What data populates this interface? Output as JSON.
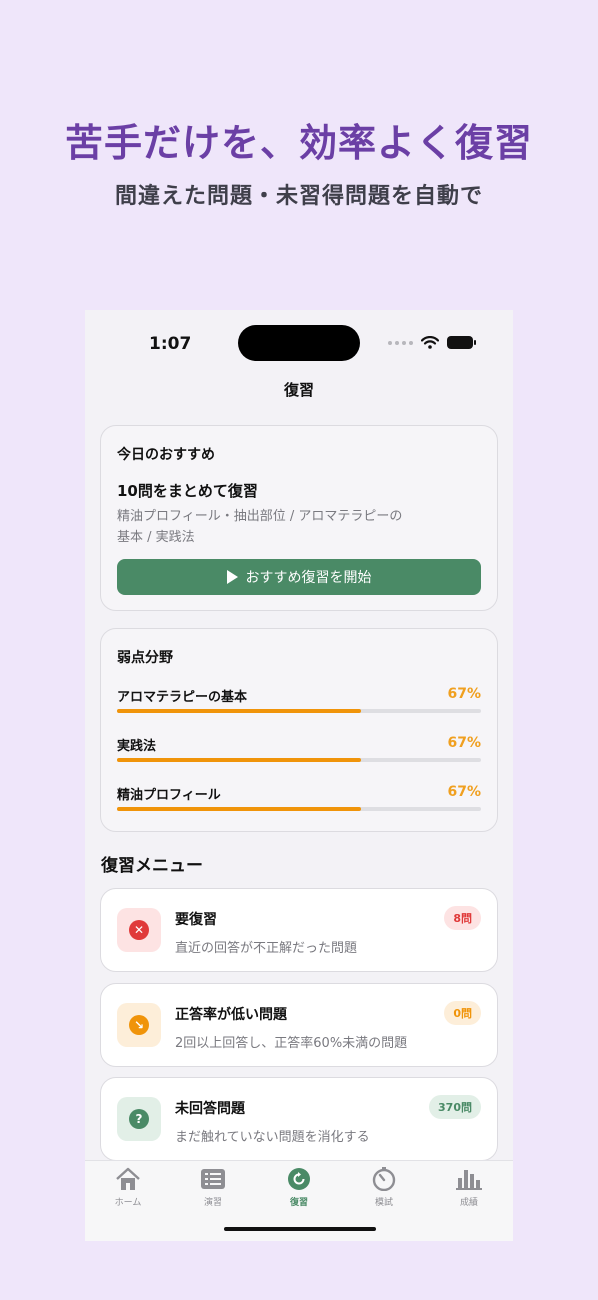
{
  "promo": {
    "title": "苦手だけを、効率よく復習",
    "subtitle": "間違えた問題・未習得問題を自動で"
  },
  "status_bar": {
    "time": "1:07"
  },
  "nav": {
    "title": "復習"
  },
  "recommendation": {
    "heading": "今日のおすすめ",
    "title": "10問をまとめて復習",
    "topics_line1": "精油プロフィール・抽出部位 / アロマテラピーの",
    "topics_line2": "基本 / 実践法",
    "button_label": "おすすめ復習を開始"
  },
  "weak_areas": {
    "heading": "弱点分野",
    "items": [
      {
        "name": "アロマテラピーの基本",
        "percent_label": "67%",
        "value": 0.67
      },
      {
        "name": "実践法",
        "percent_label": "67%",
        "value": 0.67
      },
      {
        "name": "精油プロフィール",
        "percent_label": "67%",
        "value": 0.67
      }
    ]
  },
  "review_menu": {
    "heading": "復習メニュー",
    "items": [
      {
        "title": "要復習",
        "description": "直近の回答が不正解だった問題",
        "badge": "8問",
        "icon": "x-circle-icon",
        "glyph": "✕",
        "icon_bg": "#fde3e3",
        "icon_color": "#e03a3a",
        "badge_bg": "#fde3e3",
        "badge_color": "#e03a3a"
      },
      {
        "title": "正答率が低い問題",
        "description": "2回以上回答し、正答率60%未満の問題",
        "badge": "0問",
        "icon": "trend-down-icon",
        "glyph": "↘",
        "icon_bg": "#fdeed9",
        "icon_color": "#f0940a",
        "badge_bg": "#fdeed9",
        "badge_color": "#f0940a"
      },
      {
        "title": "未回答問題",
        "description": "まだ触れていない問題を消化する",
        "badge": "370問",
        "icon": "question-circle-icon",
        "glyph": "?",
        "icon_bg": "#e2efe7",
        "icon_color": "#4a8a66",
        "badge_bg": "#e2efe7",
        "badge_color": "#4a8a66"
      }
    ]
  },
  "tabbar": {
    "tabs": [
      {
        "label": "ホーム",
        "icon": "home-icon"
      },
      {
        "label": "演習",
        "icon": "list-icon"
      },
      {
        "label": "復習",
        "icon": "review-icon",
        "active": true
      },
      {
        "label": "模試",
        "icon": "timer-icon"
      },
      {
        "label": "成績",
        "icon": "bar-chart-icon"
      }
    ]
  },
  "colors": {
    "brand_purple": "#6b3fa5",
    "accent_green": "#4a8a66",
    "warning_orange": "#f0940a",
    "error_red": "#e03a3a"
  }
}
